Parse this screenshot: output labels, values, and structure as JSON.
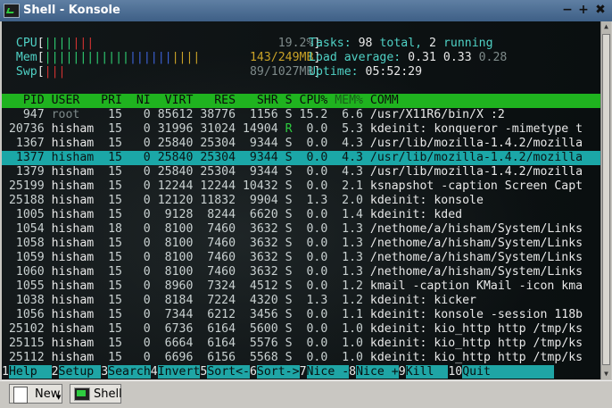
{
  "window": {
    "title": "Shell - Konsole",
    "buttons": [
      "−",
      "+",
      "✖"
    ]
  },
  "meters": {
    "cpu": {
      "label": "CPU",
      "value": "19.2%",
      "fraction": 0.192
    },
    "mem": {
      "label": "Mem",
      "value": "143/249MB",
      "fraction": 0.574
    },
    "swp": {
      "label": "Swp",
      "value": "89/1027MB",
      "fraction": 0.087
    }
  },
  "summary": {
    "tasks_label": "Tasks:",
    "tasks": "98",
    "total_label": "total,",
    "running": "2",
    "running_label": "running",
    "load_label": "Load average:",
    "load1": "0.31",
    "load5": "0.33",
    "load15": "0.28",
    "uptime_label": "Uptime:",
    "uptime": "05:52:29"
  },
  "columns": [
    "PID",
    "USER",
    "PRI",
    "NI",
    "VIRT",
    "RES",
    "SHR",
    "S",
    "CPU%",
    "MEM%",
    "COMM"
  ],
  "processes": [
    {
      "pid": "947",
      "user": "root",
      "pri": "15",
      "ni": "0",
      "virt": "85612",
      "res": "38776",
      "shr": "1156",
      "s": "S",
      "cpu": "15.2",
      "mem": "6.6",
      "comm": "/usr/X11R6/bin/X :2"
    },
    {
      "pid": "20736",
      "user": "hisham",
      "pri": "15",
      "ni": "0",
      "virt": "31996",
      "res": "31024",
      "shr": "14904",
      "s": "R",
      "cpu": "0.0",
      "mem": "5.3",
      "comm": "kdeinit: konqueror -mimetype t"
    },
    {
      "pid": "1367",
      "user": "hisham",
      "pri": "15",
      "ni": "0",
      "virt": "25840",
      "res": "25304",
      "shr": "9344",
      "s": "S",
      "cpu": "0.0",
      "mem": "4.3",
      "comm": "/usr/lib/mozilla-1.4.2/mozilla"
    },
    {
      "pid": "1377",
      "user": "hisham",
      "pri": "15",
      "ni": "0",
      "virt": "25840",
      "res": "25304",
      "shr": "9344",
      "s": "S",
      "cpu": "0.0",
      "mem": "4.3",
      "comm": "/usr/lib/mozilla-1.4.2/mozilla",
      "selected": true
    },
    {
      "pid": "1379",
      "user": "hisham",
      "pri": "15",
      "ni": "0",
      "virt": "25840",
      "res": "25304",
      "shr": "9344",
      "s": "S",
      "cpu": "0.0",
      "mem": "4.3",
      "comm": "/usr/lib/mozilla-1.4.2/mozilla"
    },
    {
      "pid": "25199",
      "user": "hisham",
      "pri": "15",
      "ni": "0",
      "virt": "12244",
      "res": "12244",
      "shr": "10432",
      "s": "S",
      "cpu": "0.0",
      "mem": "2.1",
      "comm": "ksnapshot -caption Screen Capt"
    },
    {
      "pid": "25188",
      "user": "hisham",
      "pri": "15",
      "ni": "0",
      "virt": "12120",
      "res": "11832",
      "shr": "9904",
      "s": "S",
      "cpu": "1.3",
      "mem": "2.0",
      "comm": "kdeinit: konsole"
    },
    {
      "pid": "1005",
      "user": "hisham",
      "pri": "15",
      "ni": "0",
      "virt": "9128",
      "res": "8244",
      "shr": "6620",
      "s": "S",
      "cpu": "0.0",
      "mem": "1.4",
      "comm": "kdeinit: kded"
    },
    {
      "pid": "1054",
      "user": "hisham",
      "pri": "18",
      "ni": "0",
      "virt": "8100",
      "res": "7460",
      "shr": "3632",
      "s": "S",
      "cpu": "0.0",
      "mem": "1.3",
      "comm": "/nethome/a/hisham/System/Links"
    },
    {
      "pid": "1058",
      "user": "hisham",
      "pri": "15",
      "ni": "0",
      "virt": "8100",
      "res": "7460",
      "shr": "3632",
      "s": "S",
      "cpu": "0.0",
      "mem": "1.3",
      "comm": "/nethome/a/hisham/System/Links"
    },
    {
      "pid": "1059",
      "user": "hisham",
      "pri": "15",
      "ni": "0",
      "virt": "8100",
      "res": "7460",
      "shr": "3632",
      "s": "S",
      "cpu": "0.0",
      "mem": "1.3",
      "comm": "/nethome/a/hisham/System/Links"
    },
    {
      "pid": "1060",
      "user": "hisham",
      "pri": "15",
      "ni": "0",
      "virt": "8100",
      "res": "7460",
      "shr": "3632",
      "s": "S",
      "cpu": "0.0",
      "mem": "1.3",
      "comm": "/nethome/a/hisham/System/Links"
    },
    {
      "pid": "1055",
      "user": "hisham",
      "pri": "15",
      "ni": "0",
      "virt": "8960",
      "res": "7324",
      "shr": "4512",
      "s": "S",
      "cpu": "0.0",
      "mem": "1.2",
      "comm": "kmail -caption KMail -icon kma"
    },
    {
      "pid": "1038",
      "user": "hisham",
      "pri": "15",
      "ni": "0",
      "virt": "8184",
      "res": "7224",
      "shr": "4320",
      "s": "S",
      "cpu": "1.3",
      "mem": "1.2",
      "comm": "kdeinit: kicker"
    },
    {
      "pid": "1056",
      "user": "hisham",
      "pri": "15",
      "ni": "0",
      "virt": "7344",
      "res": "6212",
      "shr": "3456",
      "s": "S",
      "cpu": "0.0",
      "mem": "1.1",
      "comm": "kdeinit: konsole -session 118b"
    },
    {
      "pid": "25102",
      "user": "hisham",
      "pri": "15",
      "ni": "0",
      "virt": "6736",
      "res": "6164",
      "shr": "5600",
      "s": "S",
      "cpu": "0.0",
      "mem": "1.0",
      "comm": "kdeinit: kio_http http /tmp/ks"
    },
    {
      "pid": "25115",
      "user": "hisham",
      "pri": "15",
      "ni": "0",
      "virt": "6664",
      "res": "6164",
      "shr": "5576",
      "s": "S",
      "cpu": "0.0",
      "mem": "1.0",
      "comm": "kdeinit: kio_http http /tmp/ks"
    },
    {
      "pid": "25112",
      "user": "hisham",
      "pri": "15",
      "ni": "0",
      "virt": "6696",
      "res": "6156",
      "shr": "5568",
      "s": "S",
      "cpu": "0.0",
      "mem": "1.0",
      "comm": "kdeinit: kio_http http /tmp/ks"
    }
  ],
  "function_keys": [
    {
      "key": "1",
      "label": "Help"
    },
    {
      "key": "2",
      "label": "Setup"
    },
    {
      "key": "3",
      "label": "Search"
    },
    {
      "key": "4",
      "label": "Invert"
    },
    {
      "key": "5",
      "label": "Sort<-"
    },
    {
      "key": "6",
      "label": "Sort->"
    },
    {
      "key": "7",
      "label": "Nice -"
    },
    {
      "key": "8",
      "label": "Nice +"
    },
    {
      "key": "9",
      "label": "Kill"
    },
    {
      "key": "10",
      "label": "Quit"
    }
  ],
  "taskbar": {
    "new_label": "New",
    "shell_label": "Shell"
  },
  "colors": {
    "header_bg": "#1fb31f",
    "selected_bg": "#1ba7a7",
    "terminal_bg": "#0a0f10",
    "fkey_bg": "#1fa5a5"
  }
}
